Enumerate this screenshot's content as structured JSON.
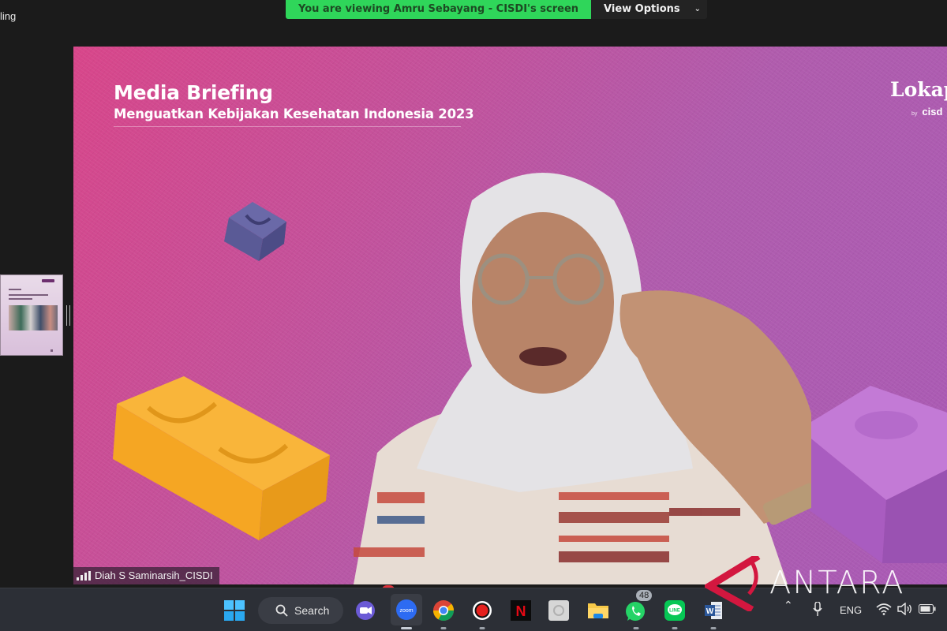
{
  "share_banner": {
    "viewing_text": "You are viewing Amru Sebayang - CISDI's screen",
    "view_options_label": "View Options"
  },
  "top_left_text": "ling",
  "slide": {
    "title": "Media Briefing",
    "subtitle": "Menguatkan Kebijakan Kesehatan Indonesia 2023",
    "brand": "Lokap",
    "brand_sub_prefix": "by",
    "brand_sub": "cisd"
  },
  "participant": {
    "name": "Diah S Saminarsih_CISDI"
  },
  "taskbar": {
    "search_label": "Search",
    "apps": [
      {
        "name": "start",
        "label": "Start"
      },
      {
        "name": "teams",
        "label": "Teams"
      },
      {
        "name": "zoom",
        "label": "zoom"
      },
      {
        "name": "chrome",
        "label": "Chrome"
      },
      {
        "name": "recorder",
        "label": "Recorder"
      },
      {
        "name": "netflix",
        "label": "N"
      },
      {
        "name": "app-gray",
        "label": ""
      },
      {
        "name": "file-explorer",
        "label": "File Explorer"
      },
      {
        "name": "whatsapp",
        "label": "WhatsApp",
        "badge": "48"
      },
      {
        "name": "line",
        "label": "LINE"
      },
      {
        "name": "word",
        "label": "W"
      }
    ],
    "tray": {
      "language": "ENG"
    }
  },
  "watermark": "ANTARA",
  "colors": {
    "banner_green": "#2fd65a",
    "taskbar_bg": "#2c2f36",
    "antara_red": "#d3173f"
  }
}
